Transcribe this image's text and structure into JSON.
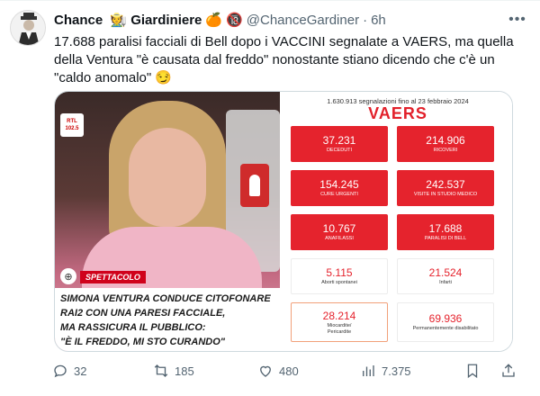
{
  "author": {
    "name": "Chance",
    "name_suffix": "Giardiniere",
    "handle": "@ChanceGardiner",
    "time": "6h"
  },
  "tweet_text": "17.688 paralisi facciali di Bell dopo i VACCINI segnalate a VAERS, ma quella della Ventura \"è causata dal freddo\" nonostante stiano dicendo che c'è un \"caldo anomalo\" 😏",
  "photo": {
    "channel_logo": "RTL 102.5",
    "tag": "SPETTACOLO",
    "headline": [
      "SIMONA VENTURA CONDUCE CITOFONARE",
      "RAI2 CON UNA PARESI FACCIALE,",
      "MA RASSICURA IL PUBBLICO:",
      "\"È IL FREDDO, MI STO CURANDO\""
    ]
  },
  "infographic": {
    "subtitle": "1.630.913 segnalazioni fino al 23 febbraio 2024",
    "title": "VAERS",
    "boxes": [
      {
        "value": "37.231",
        "label": "DECEDUTI",
        "style": "red"
      },
      {
        "value": "214.906",
        "label": "RICOVERI",
        "style": "red"
      },
      {
        "value": "154.245",
        "label": "CURE URGENTI",
        "style": "red"
      },
      {
        "value": "242.537",
        "label": "VISITE IN STUDIO MEDICO",
        "style": "red"
      },
      {
        "value": "10.767",
        "label": "ANAFILASSI",
        "style": "red"
      },
      {
        "value": "17.688",
        "label": "PARALISI DI BELL",
        "style": "red"
      },
      {
        "value": "5.115",
        "label": "Aborti spontanei",
        "style": "white"
      },
      {
        "value": "21.524",
        "label": "Infarti",
        "style": "white"
      },
      {
        "value": "28.214",
        "label": "Miocardite/ Pericardite",
        "style": "outlined"
      },
      {
        "value": "69.936",
        "label": "Permanentemente disabilitato",
        "style": "white"
      }
    ]
  },
  "actions": {
    "replies": "32",
    "reposts": "185",
    "likes": "480",
    "views": "7.375"
  },
  "colors": {
    "accent_red": "#e5232d",
    "text_secondary": "#536471"
  }
}
